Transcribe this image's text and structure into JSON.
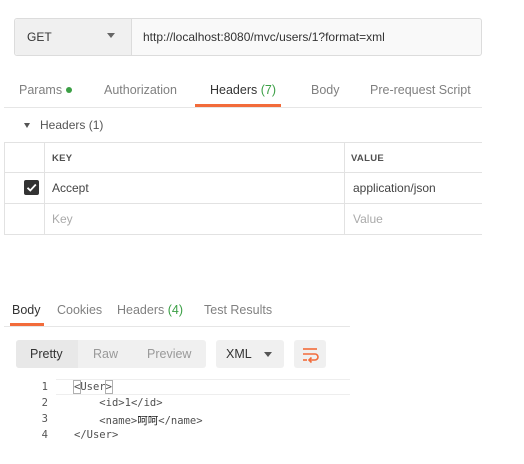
{
  "request": {
    "method": "GET",
    "url": "http://localhost:8080/mvc/users/1?format=xml"
  },
  "request_tabs": [
    {
      "label": "Params",
      "count": "",
      "dot": true,
      "active": false
    },
    {
      "label": "Authorization",
      "count": "",
      "dot": false,
      "active": false
    },
    {
      "label": "Headers ",
      "count": "(7)",
      "dot": false,
      "active": true
    },
    {
      "label": "Body",
      "count": "",
      "dot": false,
      "active": false
    },
    {
      "label": "Pre-request Script",
      "count": "",
      "dot": false,
      "active": false
    }
  ],
  "headers_section": {
    "title": "Headers (1)",
    "columns": {
      "key": "KEY",
      "value": "VALUE"
    },
    "rows": [
      {
        "checked": true,
        "key": "Accept",
        "value": "application/json"
      }
    ],
    "placeholder": {
      "key": "Key",
      "value": "Value"
    }
  },
  "response_tabs": [
    {
      "label": "Body",
      "count": "",
      "active": true
    },
    {
      "label": "Cookies",
      "count": "",
      "active": false
    },
    {
      "label": "Headers ",
      "count": "(4)",
      "active": false
    },
    {
      "label": "Test Results",
      "count": "",
      "active": false
    }
  ],
  "view_modes": [
    {
      "label": "Pretty",
      "active": true
    },
    {
      "label": "Raw",
      "active": false
    },
    {
      "label": "Preview",
      "active": false
    }
  ],
  "format": "XML",
  "wrap_icon": "wrap-lines-icon",
  "code": {
    "line_numbers": [
      "1",
      "2",
      "3",
      "4"
    ],
    "lines": [
      {
        "indent": "",
        "open": "User",
        "text": "",
        "close": ""
      },
      {
        "indent": "    ",
        "open": "id",
        "text": "1",
        "close": "id"
      },
      {
        "indent": "    ",
        "open": "name",
        "text": "呵呵",
        "close": "name"
      },
      {
        "indent": "",
        "open": "",
        "text": "",
        "close": "User"
      }
    ]
  },
  "colors": {
    "accent": "#f26b3a",
    "count_green": "#3b9f45"
  }
}
